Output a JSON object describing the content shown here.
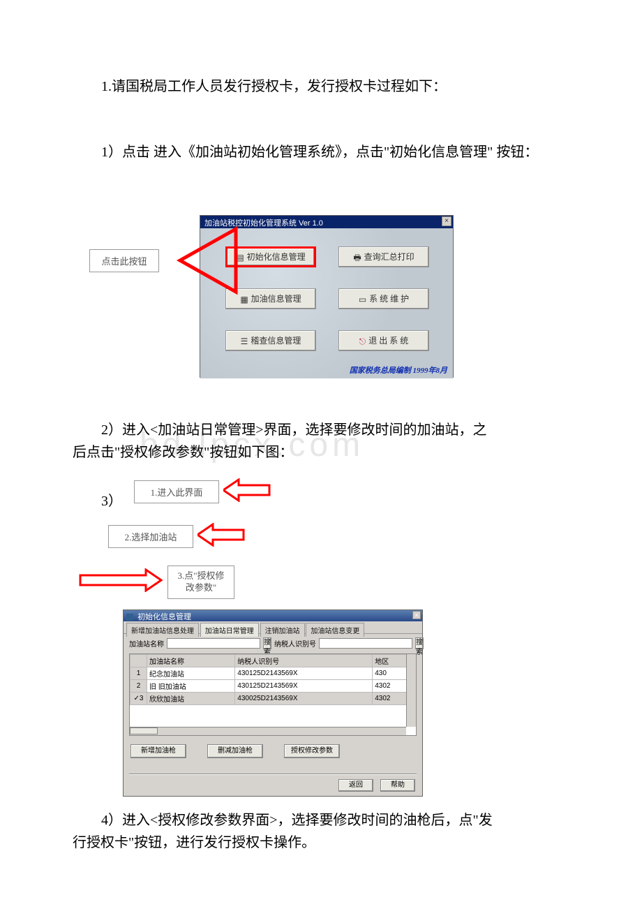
{
  "paragraphs": {
    "p1": "1.请国税局工作人员发行授权卡，发行授权卡过程如下：",
    "p2": "1）点击 进入《加油站初始化管理系统》，点击\"初始化信息管理\" 按钮：",
    "p3a": "2）进入<加油站日常管理>界面，选择要修改时间的加油站，之",
    "p3b": "后点击\"授权修改参数\"按钮如下图：",
    "p3_num": "3）",
    "p4a": "4）进入<授权修改参数界面>，选择要修改时间的油枪后，点\"发",
    "p4b": "行授权卡\"按钮，进行发行授权卡操作。"
  },
  "watermark": "bd    lpcx.com",
  "callout1": "点击此按钮",
  "step_boxes": {
    "s1": "1.进入此界面",
    "s2": "2.选择加油站",
    "s3": "3.点\"授权修改参数\""
  },
  "win1": {
    "title": "加油站税控初始化管理系统 Ver 1.0",
    "close": "×",
    "buttons": {
      "init_mgmt": "初始化信息管理",
      "query_print": "查询汇总打印",
      "add_info": "加油信息管理",
      "sys_maint": "系 统 维 护",
      "audit_info": "稽查信息管理",
      "exit": "退 出 系 统"
    },
    "footer": "国家税务总局编制  1999年8月"
  },
  "win2": {
    "title": "初始化信息管理",
    "close": "×",
    "tabs": {
      "t1": "新增加油站信息处理",
      "t2": "加油站日常管理",
      "t3": "注销加油站",
      "t4": "加油站信息变更"
    },
    "search": {
      "label1": "加油站名称",
      "btn1": "搜索",
      "label2": "纳税人识别号",
      "btn2": "搜索"
    },
    "grid": {
      "headers": {
        "c0": "",
        "c1": "加油站名称",
        "c2": "纳税人识别号",
        "c3": "地区"
      },
      "rows": [
        {
          "n": "1",
          "name": "纪念加油站",
          "tax": "430125D2143569X",
          "area": "430"
        },
        {
          "n": "2",
          "name": "旧 旧加油站",
          "tax": "430125D2143569X",
          "area": "4302"
        },
        {
          "n": "3",
          "name": "欣欣加油站",
          "tax": "430025D2143569X",
          "area": "4302"
        }
      ],
      "selmark": "✓3"
    },
    "buttons": {
      "add_gun": "新增加油枪",
      "del_gun": "删减加油枪",
      "auth_mod": "授权修改参数"
    },
    "footer": {
      "back": "返回",
      "help": "帮助"
    }
  }
}
